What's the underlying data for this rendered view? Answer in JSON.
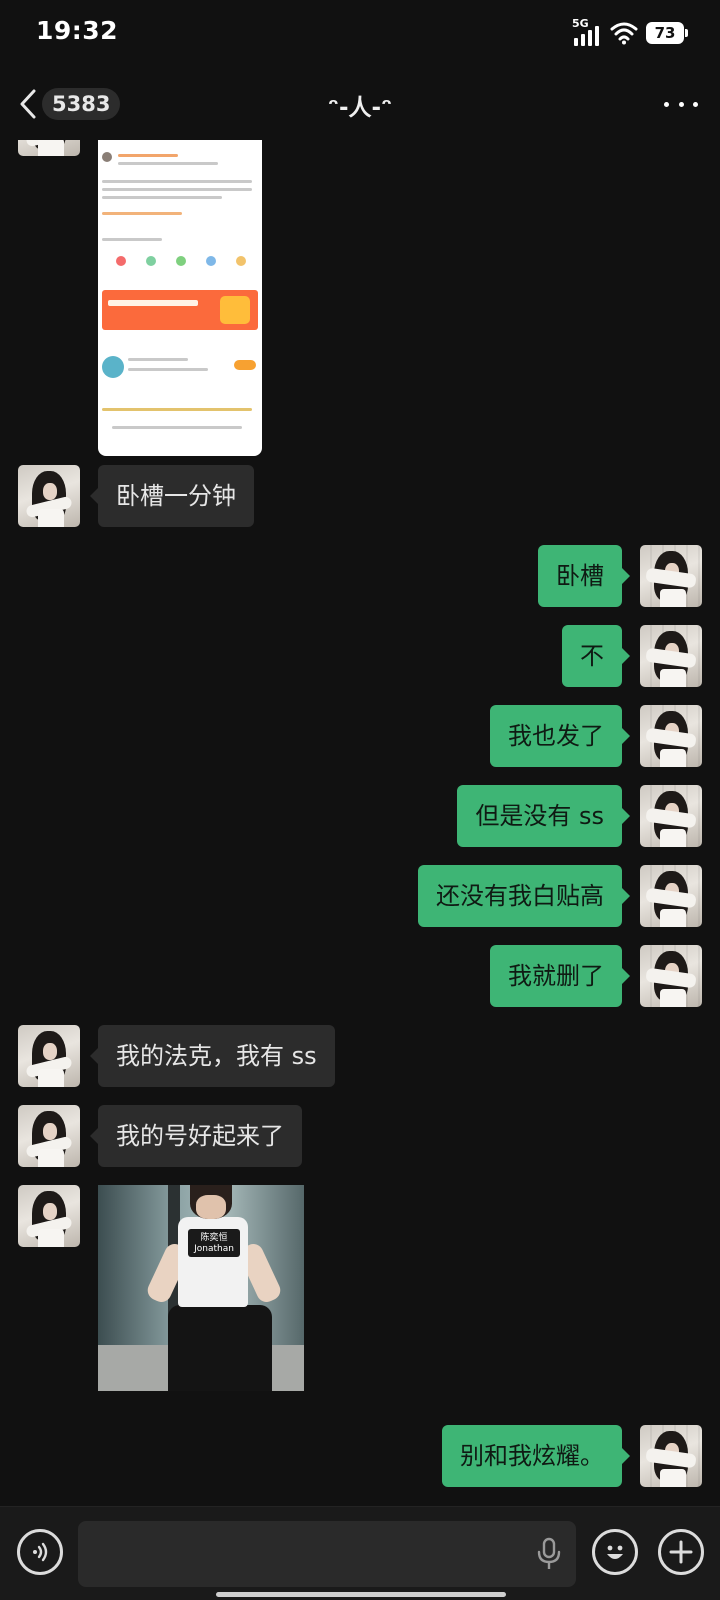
{
  "status_bar": {
    "time": "19:32",
    "network": "5G",
    "battery": "73"
  },
  "header": {
    "back_count": "5383",
    "title": "ᵔ-人-ᵔ",
    "more_icon": "more-dots-icon"
  },
  "messages": [
    {
      "side": "left",
      "type": "image",
      "description": "screenshot"
    },
    {
      "side": "left",
      "type": "text",
      "text": "卧槽一分钟"
    },
    {
      "side": "right",
      "type": "text",
      "text": "卧槽"
    },
    {
      "side": "right",
      "type": "text",
      "text": "不"
    },
    {
      "side": "right",
      "type": "text",
      "text": "我也发了"
    },
    {
      "side": "right",
      "type": "text",
      "text": "但是没有 ss"
    },
    {
      "side": "right",
      "type": "text",
      "text": "还没有我白贴高"
    },
    {
      "side": "right",
      "type": "text",
      "text": "我就删了"
    },
    {
      "side": "left",
      "type": "text",
      "text": "我的法克，我有 ss"
    },
    {
      "side": "left",
      "type": "text",
      "text": "我的号好起来了"
    },
    {
      "side": "left",
      "type": "sticker",
      "label": "陈奕恒 Jonathan"
    },
    {
      "side": "right",
      "type": "text",
      "text": "别和我炫耀。"
    }
  ],
  "colors": {
    "background": "#111111",
    "bubble_left": "#2c2c2c",
    "bubble_right": "#3eb575",
    "input_bar": "#1a1a1a"
  },
  "input_bar": {
    "placeholder": ""
  }
}
